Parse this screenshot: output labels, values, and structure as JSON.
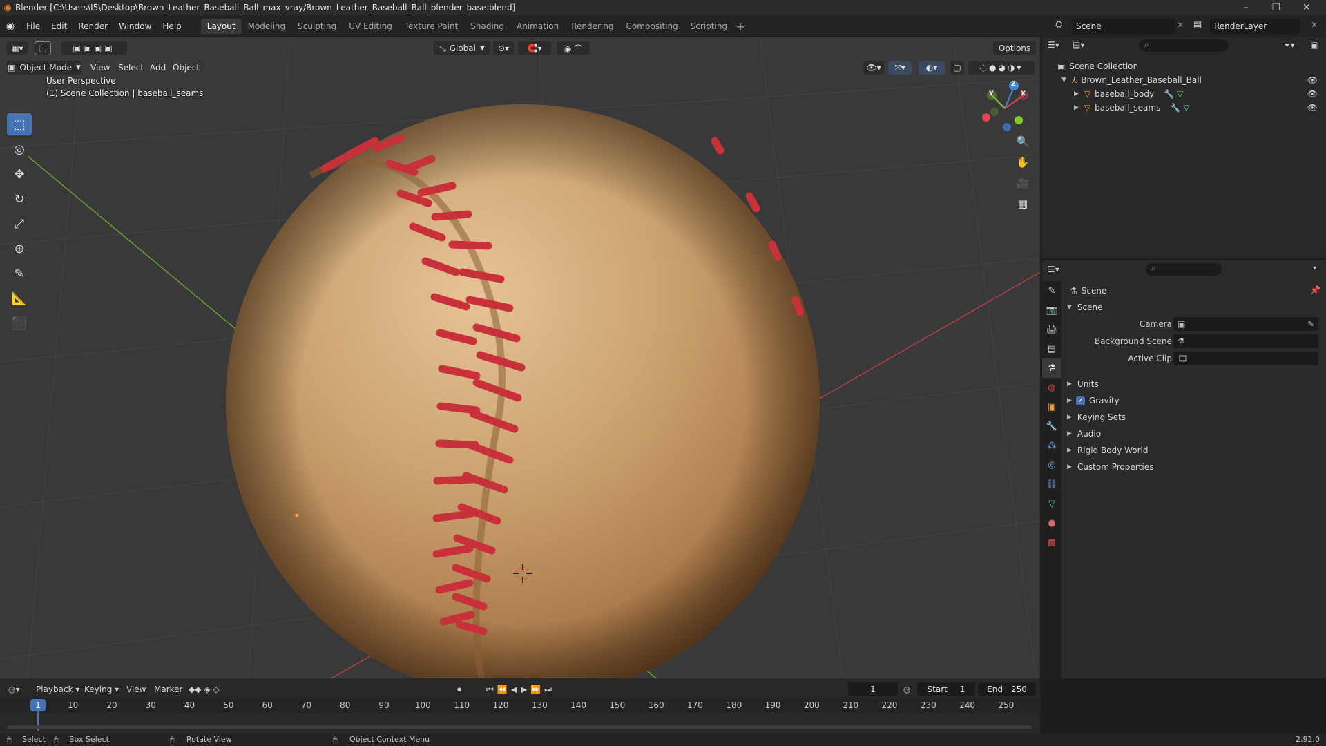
{
  "window": {
    "title": "Blender [C:\\Users\\I5\\Desktop\\Brown_Leather_Baseball_Ball_max_vray/Brown_Leather_Baseball_Ball_blender_base.blend]",
    "controls": [
      "–",
      "❐",
      "✕"
    ]
  },
  "menu": {
    "items": [
      "File",
      "Edit",
      "Render",
      "Window",
      "Help"
    ],
    "workspaces": [
      "Layout",
      "Modeling",
      "Sculpting",
      "UV Editing",
      "Texture Paint",
      "Shading",
      "Animation",
      "Rendering",
      "Compositing",
      "Scripting"
    ],
    "active_workspace": "Layout",
    "add_workspace": "+",
    "scene_name": "Scene",
    "render_layer": "RenderLayer"
  },
  "viewport": {
    "mode": "Object Mode",
    "menus": [
      "View",
      "Select",
      "Add",
      "Object"
    ],
    "transform_orientation": "Global",
    "options_label": "Options",
    "perspective_label": "User Perspective",
    "collection_label": "(1) Scene Collection | baseball_seams",
    "gizmo_axes": [
      "X",
      "Y",
      "Z"
    ]
  },
  "outliner": {
    "root": "Scene Collection",
    "collection": "Brown_Leather_Baseball_Ball",
    "objects": [
      "baseball_body",
      "baseball_seams"
    ]
  },
  "properties": {
    "context": "Scene",
    "panel": "Scene",
    "fields": [
      {
        "label": "Camera",
        "value": ""
      },
      {
        "label": "Background Scene",
        "value": ""
      },
      {
        "label": "Active Clip",
        "value": ""
      }
    ],
    "subpanels": [
      {
        "label": "Units",
        "checkbox": false
      },
      {
        "label": "Gravity",
        "checkbox": true
      },
      {
        "label": "Keying Sets",
        "checkbox": false
      },
      {
        "label": "Audio",
        "checkbox": false
      },
      {
        "label": "Rigid Body World",
        "checkbox": false
      },
      {
        "label": "Custom Properties",
        "checkbox": false
      }
    ]
  },
  "timeline": {
    "menus": [
      "Playback",
      "Keying",
      "View",
      "Marker"
    ],
    "current_frame": "1",
    "start_label": "Start",
    "start_value": "1",
    "end_label": "End",
    "end_value": "250",
    "ruler": [
      "1",
      "10",
      "20",
      "30",
      "40",
      "50",
      "60",
      "70",
      "80",
      "90",
      "100",
      "110",
      "120",
      "130",
      "140",
      "150",
      "160",
      "170",
      "180",
      "190",
      "200",
      "210",
      "220",
      "230",
      "240",
      "250"
    ]
  },
  "statusbar": {
    "select": "Select",
    "box_select": "Box Select",
    "rotate_view": "Rotate View",
    "context_menu": "Object Context Menu",
    "version": "2.92.0"
  },
  "colors": {
    "accent": "#4772b3",
    "leather": "#b98a55",
    "stitch": "#c8303a",
    "x_axis": "#e5434c",
    "y_axis": "#7ecb2a",
    "z_axis": "#3f88e0"
  }
}
